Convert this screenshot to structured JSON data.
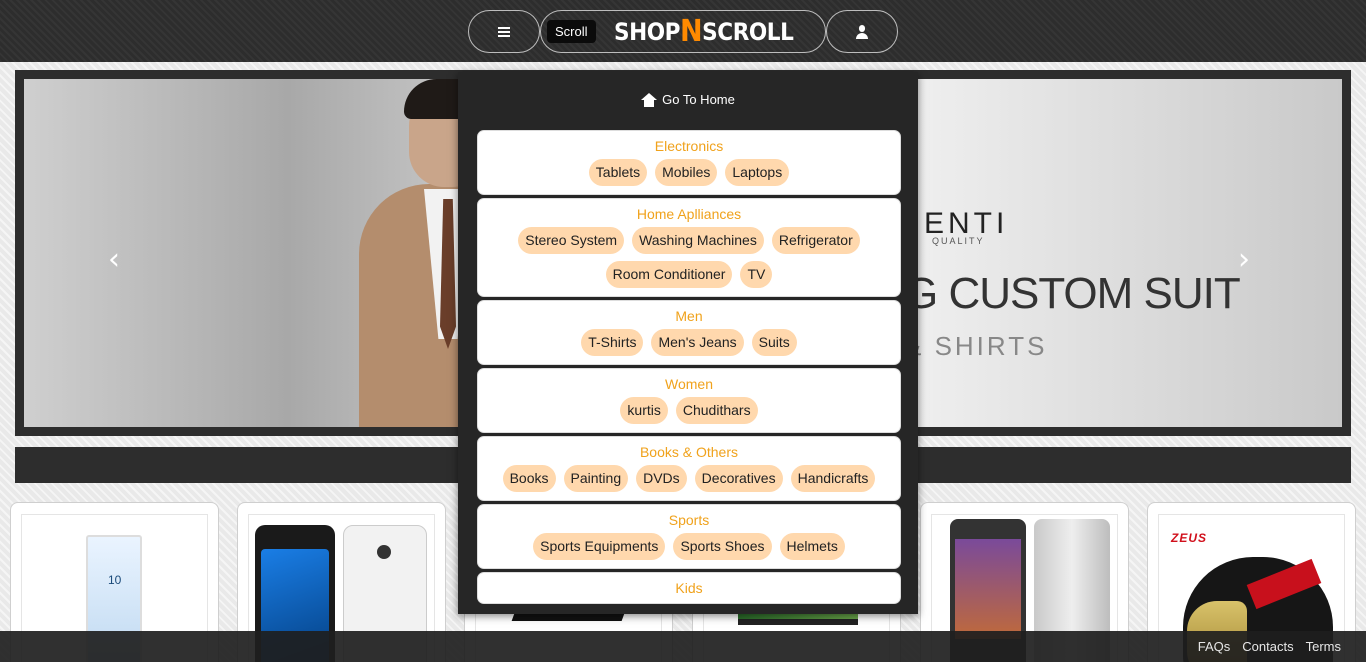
{
  "header": {
    "scroll_badge": "Scroll",
    "logo_text_1": "SHOP",
    "logo_text_n": "N",
    "logo_text_2": "SCROLL"
  },
  "carousel": {
    "sign_top": "ENTI",
    "sign_top_sub": "QUALITY",
    "sign_main": "G CUSTOM SUIT",
    "sign_sub": "& SHIRTS",
    "prev_arrow": "‹",
    "next_arrow": "›"
  },
  "menu": {
    "home_label": "Go To Home",
    "categories": [
      {
        "title": "Electronics",
        "items": [
          "Tablets",
          "Mobiles",
          "Laptops"
        ]
      },
      {
        "title": "Home Aplliances",
        "items": [
          "Stereo System",
          "Washing Machines",
          "Refrigerator",
          "Room Conditioner",
          "TV"
        ]
      },
      {
        "title": "Men",
        "items": [
          "T-Shirts",
          "Men's Jeans",
          "Suits"
        ]
      },
      {
        "title": "Women",
        "items": [
          "kurtis",
          "Chudithars"
        ]
      },
      {
        "title": "Books & Others",
        "items": [
          "Books",
          "Painting",
          "DVDs",
          "Decoratives",
          "Handicrafts"
        ]
      },
      {
        "title": "Sports",
        "items": [
          "Sports Equipments",
          "Sports Shoes",
          "Helmets"
        ]
      },
      {
        "title": "Kids",
        "items": []
      }
    ]
  },
  "products": {
    "xperia_clock": "10",
    "helmet_brand": "ZEUS"
  },
  "footer": {
    "links": [
      "FAQs",
      "Contacts",
      "Terms"
    ]
  },
  "colors": {
    "accent": "#f0a21c",
    "chip": "#ffd8ad",
    "nav_bg": "#2d2d2d"
  }
}
